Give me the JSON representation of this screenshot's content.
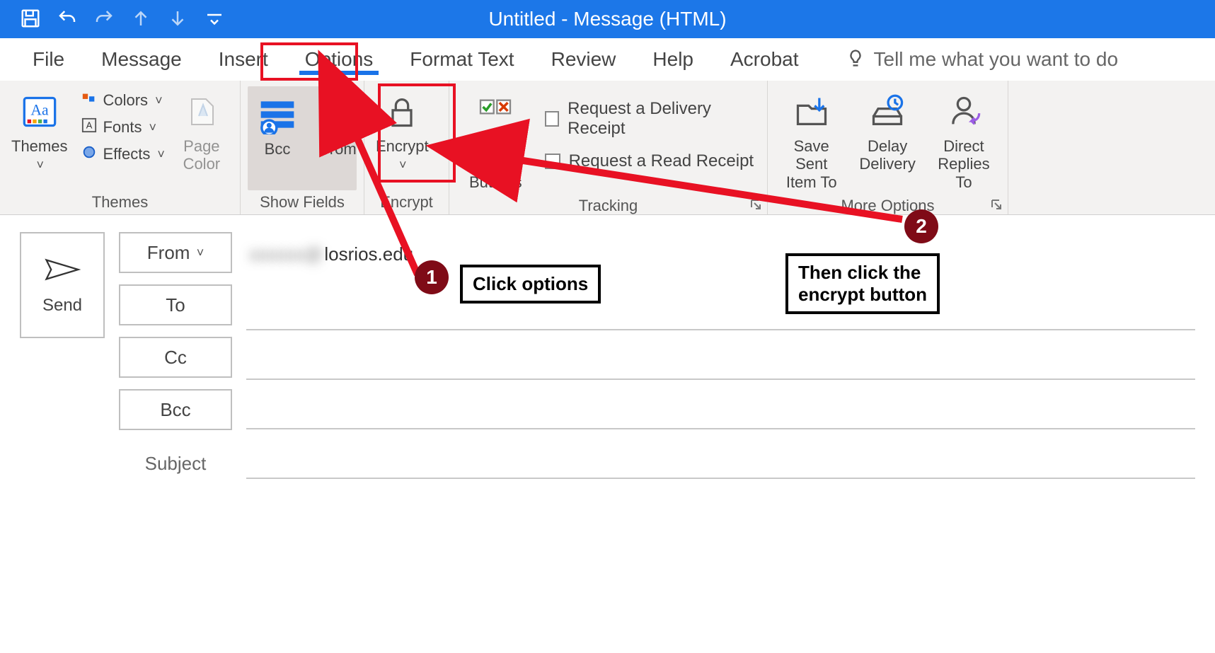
{
  "titlebar": {
    "title": "Untitled  -  Message (HTML)"
  },
  "tabs": {
    "file": "File",
    "message": "Message",
    "insert": "Insert",
    "options": "Options",
    "format_text": "Format Text",
    "review": "Review",
    "help": "Help",
    "acrobat": "Acrobat",
    "tell_me": "Tell me what you want to do"
  },
  "ribbon": {
    "themes": {
      "group_label": "Themes",
      "themes_btn": "Themes",
      "colors": "Colors",
      "fonts": "Fonts",
      "effects": "Effects",
      "page_color": "Page\nColor"
    },
    "show_fields": {
      "group_label": "Show Fields",
      "bcc": "Bcc",
      "from": "From"
    },
    "encrypt": {
      "group_label": "Encrypt",
      "encrypt_btn": "Encrypt"
    },
    "tracking": {
      "group_label": "Tracking",
      "voting": "Use Voting\nButtons",
      "delivery": "Request a Delivery Receipt",
      "read": "Request a Read Receipt"
    },
    "more_options": {
      "group_label": "More Options",
      "save_sent": "Save Sent\nItem To",
      "delay": "Delay\nDelivery",
      "direct": "Direct\nReplies To"
    }
  },
  "compose": {
    "send": "Send",
    "from_btn": "From",
    "to_btn": "To",
    "cc_btn": "Cc",
    "bcc_btn": "Bcc",
    "subject_label": "Subject",
    "from_value_suffix": "losrios.edu"
  },
  "annotations": {
    "step1_num": "1",
    "step1_text": "Click options",
    "step2_num": "2",
    "step2_text": "Then click the\nencrypt button"
  }
}
